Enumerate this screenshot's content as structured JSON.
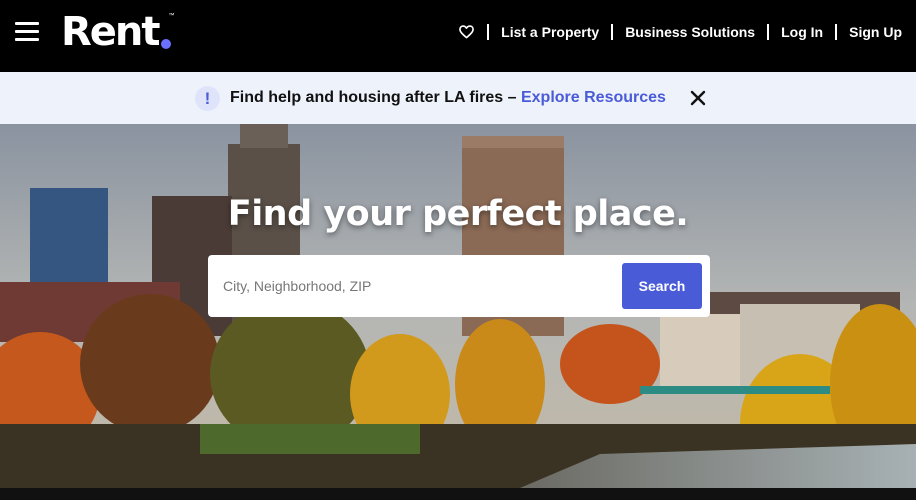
{
  "header": {
    "logo_text": "Rent",
    "logo_tm": "™",
    "nav": {
      "list_property": "List a Property",
      "business_solutions": "Business Solutions",
      "log_in": "Log In",
      "sign_up": "Sign Up"
    }
  },
  "banner": {
    "icon_text": "!",
    "message": "Find help and housing after LA fires – ",
    "link_text": "Explore Resources"
  },
  "hero": {
    "title": "Find your perfect place.",
    "search": {
      "placeholder": "City, Neighborhood, ZIP",
      "button_label": "Search"
    }
  },
  "colors": {
    "brand_accent": "#4a5bd8",
    "logo_dot": "#6a70ff",
    "banner_bg": "#eef2fb",
    "header_bg": "#000000"
  },
  "icons": [
    "menu-icon",
    "heart-icon",
    "info-icon",
    "close-icon"
  ]
}
